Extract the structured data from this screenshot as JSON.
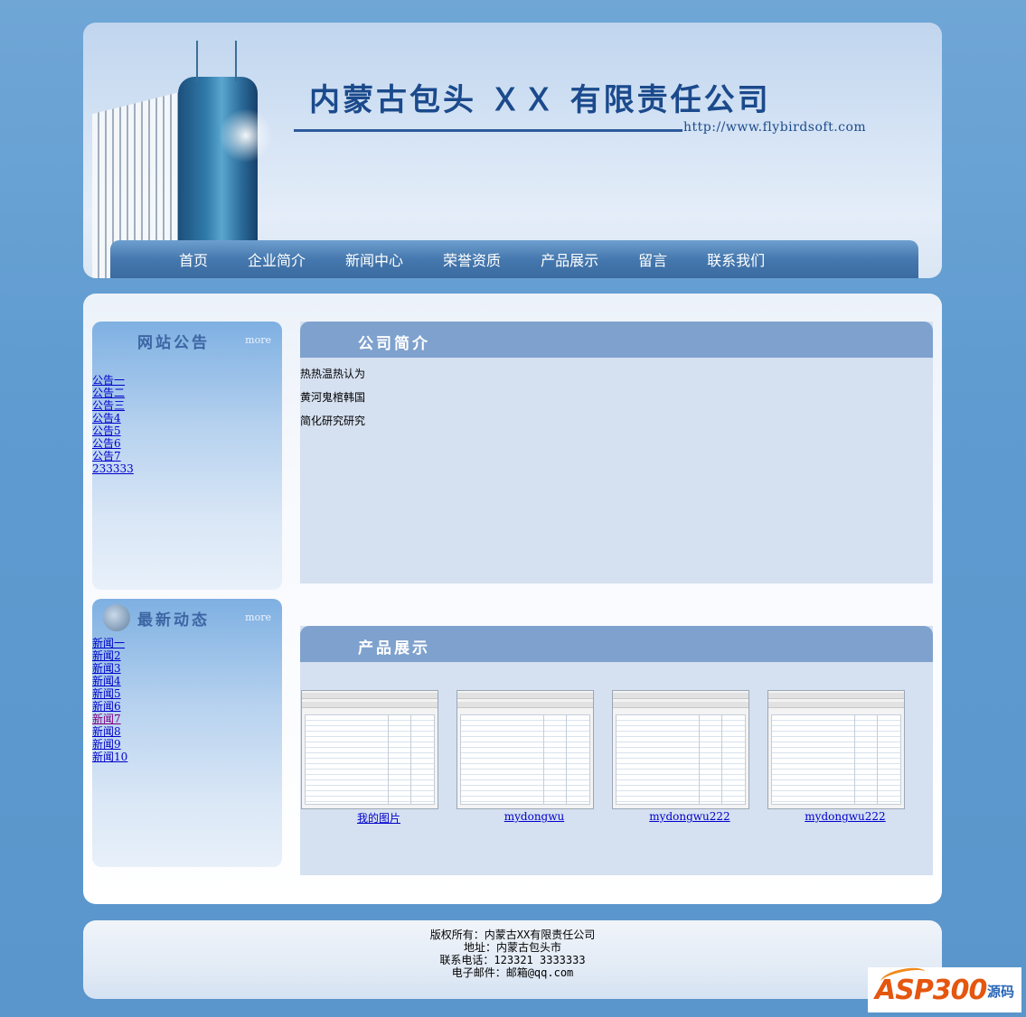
{
  "header": {
    "company_name": "内蒙古包头 ＸＸ 有限责任公司",
    "url": "http://www.flybirdsoft.com"
  },
  "nav": {
    "items": [
      {
        "label": "首页"
      },
      {
        "label": "企业简介"
      },
      {
        "label": "新闻中心"
      },
      {
        "label": "荣誉资质"
      },
      {
        "label": "产品展示"
      },
      {
        "label": "留言"
      },
      {
        "label": "联系我们"
      }
    ]
  },
  "announcements": {
    "title": "网站公告",
    "more": "more",
    "items": [
      "公告一",
      "公告二",
      "公告三",
      "公告4",
      "公告5",
      "公告6",
      "公告7",
      "233333"
    ]
  },
  "news": {
    "title": "最新动态",
    "more": "more",
    "items": [
      "新闻一",
      "新闻2",
      "新闻3",
      "新闻4",
      "新闻5",
      "新闻6",
      "新闻7",
      "新闻8",
      "新闻9",
      "新闻10"
    ]
  },
  "intro": {
    "title": "公司简介",
    "lines": [
      "热热温热认为",
      "黄河鬼棺韩国",
      "简化研究研究"
    ]
  },
  "products": {
    "title": "产品展示",
    "items": [
      {
        "name": "我的图片"
      },
      {
        "name": "mydongwu"
      },
      {
        "name": "mydongwu222"
      },
      {
        "name": "mydongwu222"
      }
    ]
  },
  "footer": {
    "copyright": "版权所有：内蒙古XX有限责任公司",
    "address": "地址：内蒙古包头市",
    "phone": "联系电话：123321   3333333",
    "email": "电子邮件：邮箱@qq.com"
  },
  "watermark": {
    "brand": "ASP300",
    "suffix": "源码"
  },
  "colors": {
    "background": "#5f9bd0",
    "nav": "#4578ae",
    "content_header": "#7fa1cd",
    "content_body": "#d5e0f0",
    "link": "#0000cc",
    "visited_link": "#800080"
  }
}
